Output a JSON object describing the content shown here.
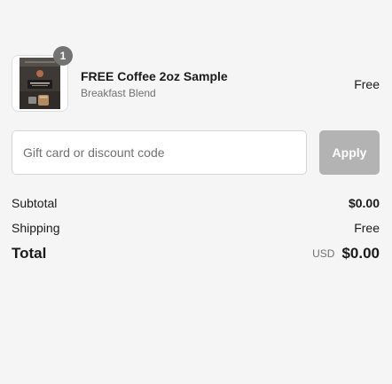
{
  "line_items": [
    {
      "quantity": "1",
      "name": "FREE Coffee 2oz Sample",
      "variant": "Breakfast Blend",
      "price": "Free",
      "image_icon": "coffee-bag-thumbnail"
    }
  ],
  "discount": {
    "placeholder": "Gift card or discount code",
    "value": "",
    "apply_label": "Apply"
  },
  "totals": {
    "subtotal_label": "Subtotal",
    "subtotal_value": "$0.00",
    "shipping_label": "Shipping",
    "shipping_value": "Free",
    "total_label": "Total",
    "total_currency": "USD",
    "total_value": "$0.00"
  },
  "colors": {
    "background": "#f5f5f5",
    "badge": "#737373",
    "apply_button_disabled": "#b3b3b3",
    "muted_text": "#707070"
  }
}
